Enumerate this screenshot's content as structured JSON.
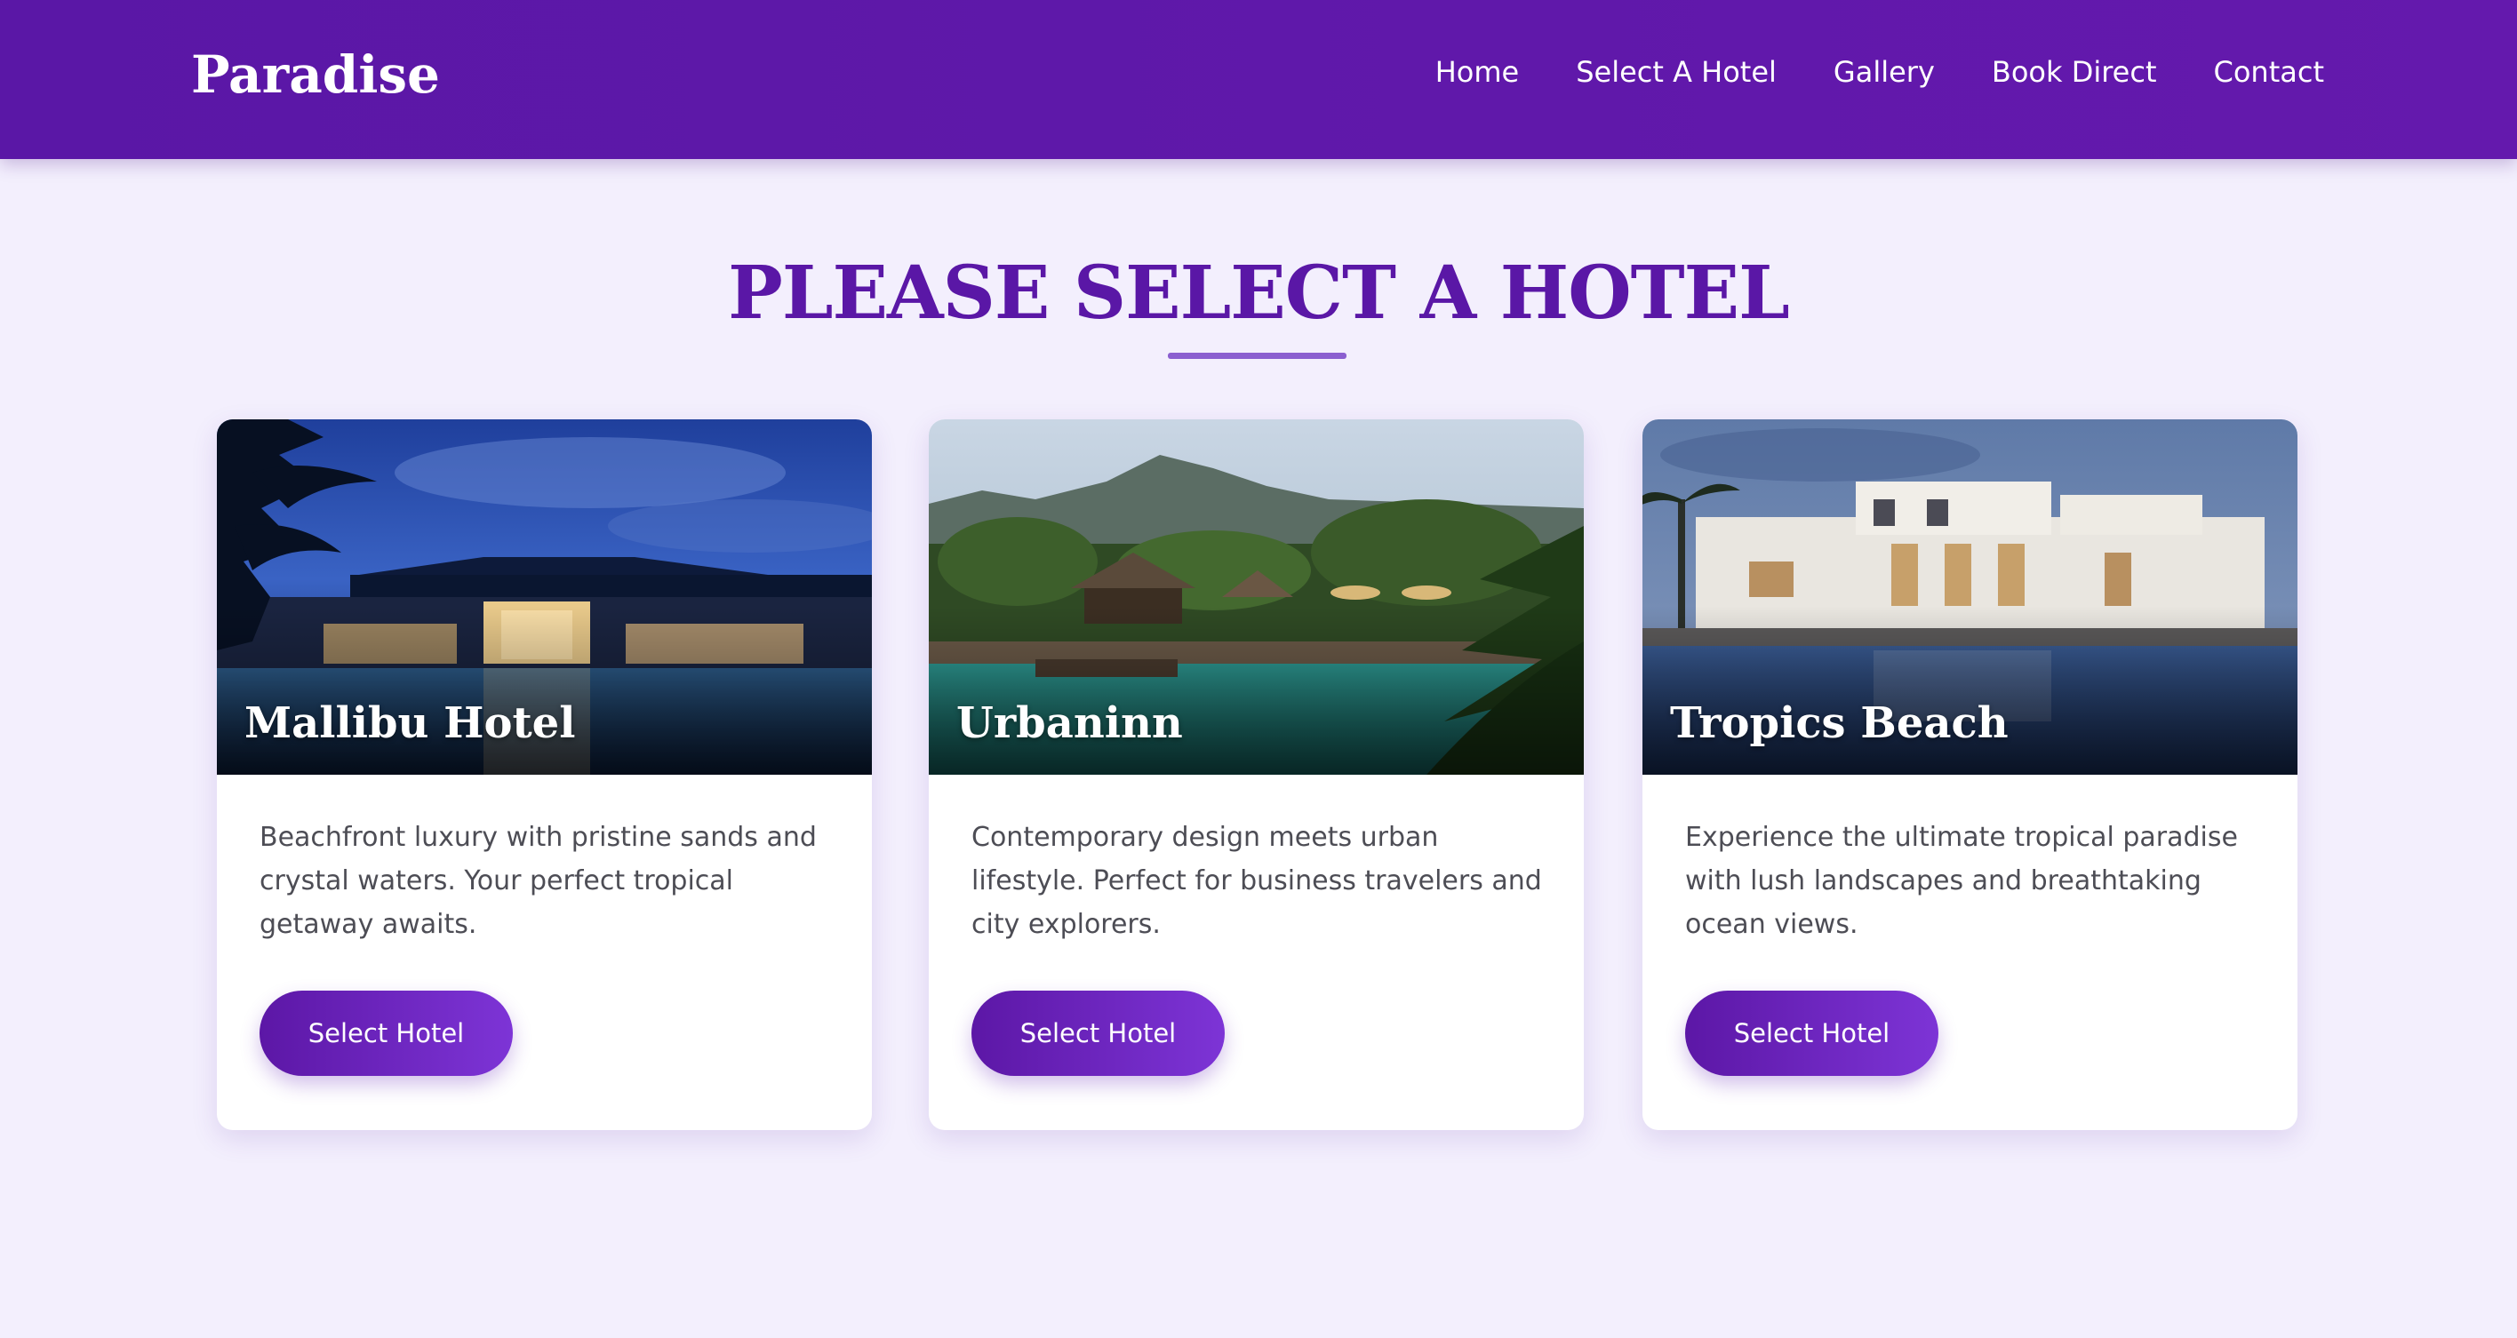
{
  "brand": {
    "logo": "Paradise",
    "colors": {
      "header": "#5f18a9",
      "accent": "#5a17a6",
      "background": "#f3effd",
      "button_gradient_start": "#5c17a6",
      "button_gradient_end": "#7d34d6"
    }
  },
  "nav": {
    "items": [
      {
        "label": "Home"
      },
      {
        "label": "Select A Hotel"
      },
      {
        "label": "Gallery"
      },
      {
        "label": "Book Direct"
      },
      {
        "label": "Contact"
      }
    ]
  },
  "main": {
    "title": "PLEASE SELECT A HOTEL",
    "hotels": [
      {
        "name": "Mallibu Hotel",
        "description": "Beachfront luxury with pristine sands and crystal waters. Your perfect tropical getaway awaits.",
        "button_label": "Select Hotel",
        "image_icon": "resort-night-pool-image"
      },
      {
        "name": "Urbaninn",
        "description": "Contemporary design meets urban lifestyle. Perfect for business travelers and city explorers.",
        "button_label": "Select Hotel",
        "image_icon": "jungle-resort-pool-image"
      },
      {
        "name": "Tropics Beach",
        "description": "Experience the ultimate tropical paradise with lush landscapes and breathtaking ocean views.",
        "button_label": "Select Hotel",
        "image_icon": "white-villa-pool-image"
      }
    ]
  }
}
